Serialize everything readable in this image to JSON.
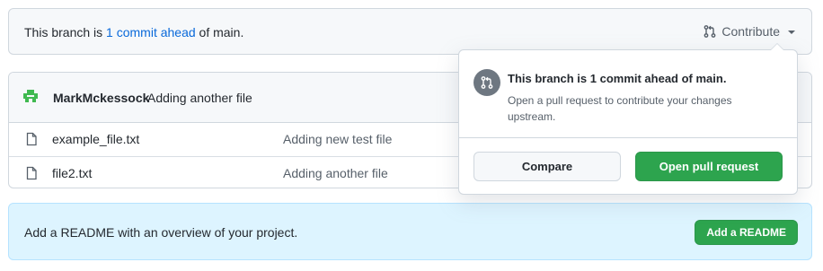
{
  "branch_status": {
    "prefix": "This branch is ",
    "link_text": "1 commit ahead",
    "suffix": " of main.",
    "contribute_label": "Contribute",
    "contribute_icon": "git-pull-request-icon",
    "dropdown_icon": "caret-down-icon"
  },
  "latest_commit": {
    "author": "MarkMckessock",
    "message": "Adding another file",
    "avatar_icon": "identicon-avatar"
  },
  "files": [
    {
      "name": "example_file.txt",
      "commit_message": "Adding new test file",
      "icon": "file-icon"
    },
    {
      "name": "file2.txt",
      "commit_message": "Adding another file",
      "icon": "file-icon"
    }
  ],
  "readme_banner": {
    "text": "Add a README with an overview of your project.",
    "button_label": "Add a README"
  },
  "contribute_popover": {
    "title": "This branch is 1 commit ahead of main.",
    "description": "Open a pull request to contribute your changes upstream.",
    "compare_label": "Compare",
    "open_pr_label": "Open pull request",
    "icon": "git-pull-request-icon"
  },
  "colors": {
    "link": "#0969da",
    "primary_button": "#2da44e",
    "banner_bg": "#ddf4ff",
    "avatar": "#3fb950"
  }
}
